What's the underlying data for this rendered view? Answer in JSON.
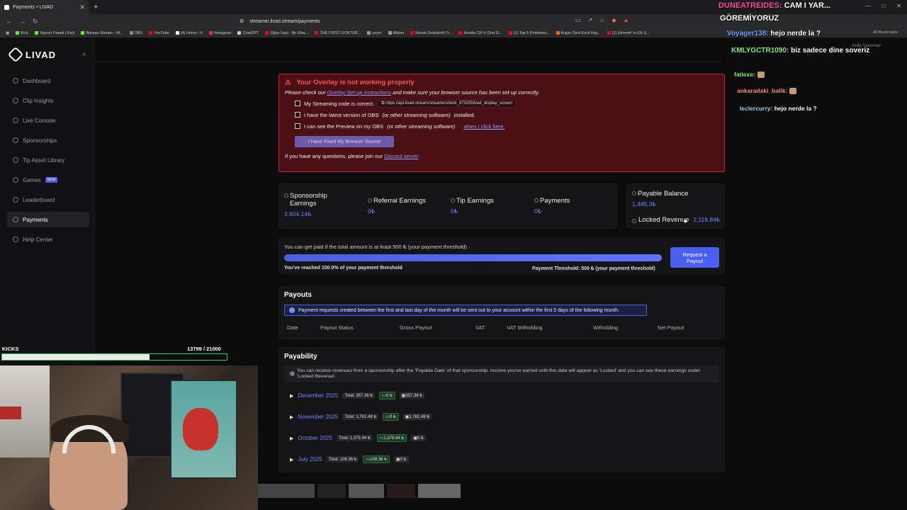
{
  "browser": {
    "tab_title": "Payments • LIVAD",
    "url": "streamer.livad.stream/payments",
    "bookmarks": [
      {
        "label": "Kick",
        "color": "#53fc18"
      },
      {
        "label": "Yayıncı Paneli | Kick",
        "color": "#53fc18"
      },
      {
        "label": "İlkinsan Stream - W...",
        "color": "#53fc18"
      },
      {
        "label": "OBS",
        "color": "#888888"
      },
      {
        "label": "YouTube",
        "color": "#ff0000"
      },
      {
        "label": "(4) Home / X",
        "color": "#ffffff"
      },
      {
        "label": "Instagram",
        "color": "#e1306c"
      },
      {
        "label": "ChatGPT",
        "color": "#cccccc"
      },
      {
        "label": "Oğuz Sasi - Bir Efsa...",
        "color": "#ff0000"
      },
      {
        "label": "THE FIRST GOKTUR...",
        "color": "#ff0000"
      },
      {
        "label": "yeyın",
        "color": "#999999"
      },
      {
        "label": "Albüm",
        "color": "#999999"
      },
      {
        "label": "Merab Dvalishvili Tr...",
        "color": "#ff0000"
      },
      {
        "label": "Honda CR-V (2nd G...",
        "color": "#ff0000"
      },
      {
        "label": "(1) Top 5 Problems...",
        "color": "#ff0000"
      },
      {
        "label": "Kişiye Özel Evcil Hay...",
        "color": "#ff6600"
      },
      {
        "label": "(1) Edremit' in EN S...",
        "color": "#ff0000"
      }
    ],
    "all_bookmarks": "All Bookmarks"
  },
  "sidebar": {
    "brand": "LIVAD",
    "items": [
      {
        "label": "Dashboard",
        "icon": "dashboard-icon"
      },
      {
        "label": "Clip Insights",
        "icon": "clip-icon"
      },
      {
        "label": "Live Console",
        "icon": "console-icon"
      },
      {
        "label": "Sponsorships",
        "icon": "sponsorship-icon"
      },
      {
        "label": "Tip Asset Library",
        "icon": "library-icon"
      },
      {
        "label": "Games",
        "icon": "games-icon",
        "badge": "NEW"
      },
      {
        "label": "Leaderboard",
        "icon": "leaderboard-icon"
      },
      {
        "label": "Payments",
        "icon": "payments-icon",
        "active": true
      },
      {
        "label": "Help Center",
        "icon": "help-icon"
      }
    ]
  },
  "alert": {
    "title": "Your Overlay is not working properly",
    "sub_prefix": "Please check our ",
    "sub_link": "Overlay Set-up Instructions",
    "sub_suffix": " and make sure your browser source has been set up correctly.",
    "check1": "My Streaming code is correct.",
    "code": "https://api.livad.stream/streamers/kick_9732556/ad_display_screen",
    "check2_prefix": "I have the latest version of OBS ",
    "check2_em": "(or other streaming software)",
    "check2_suffix": " installed.",
    "check3_prefix": "I can see the Preview on my OBS ",
    "check3_em": "(or other streaming software)",
    "check3_link": "when I click here.",
    "fixed_button": "I Have Fixed My Browser Source",
    "foot_prefix": "If you have any questions, please join our ",
    "foot_link": "Discord server"
  },
  "earnings": {
    "sponsorship_label": "Sponsorship Earnings",
    "sponsorship_value": "3,604.14₺",
    "referral_label": "Referral Earnings",
    "referral_value": "0₺",
    "tip_label": "Tip Earnings",
    "tip_value": "0₺",
    "payments_label": "Payments",
    "payments_value": "0₺"
  },
  "balance": {
    "payable_label": "Payable Balance",
    "payable_value": "1,485.3₺",
    "locked_label": "Locked Revenue",
    "locked_value": "2,118.84₺"
  },
  "threshold": {
    "text": "You can get paid if the total amount is at least 500 ₺ (your payment threshold)",
    "progress_percent": 100,
    "reached": "You've reached 100.0% of your payment threshold",
    "right": "Payment Threshold: 500 ₺ (your payment threshold)",
    "button": "Request a Payout"
  },
  "payouts": {
    "title": "Payouts",
    "info": "Payment requests created between the first and last day of the month will be sent out to your account within the first 5 days of the following month.",
    "columns": [
      "Date",
      "Payout Status",
      "Gross Payout",
      "VAT",
      "VAT Witholding",
      "Witholding",
      "Net Payout"
    ]
  },
  "payability": {
    "title": "Payability",
    "info": "You can receive revenues from a sponsorship after the 'Payable Date' of that sponsorship. Income you've earned until this date will appear as 'Locked' and you can see these earnings under 'Locked Revenue'.",
    "months": [
      {
        "name": "December 2025",
        "total": "Total: 357.36 ₺",
        "payable": "0 ₺",
        "locked": "357.36 ₺"
      },
      {
        "name": "November 2025",
        "total": "Total: 1,761.48 ₺",
        "payable": "0 ₺",
        "locked": "1,761.48 ₺"
      },
      {
        "name": "October 2025",
        "total": "Total: 1,376.94 ₺",
        "payable": "1,376.94 ₺",
        "locked": "0 ₺"
      },
      {
        "name": "July 2025",
        "total": "Total: 108.36 ₺",
        "payable": "108.36 ₺",
        "locked": "0 ₺"
      }
    ]
  },
  "stream": {
    "kicks_label": "KICKS",
    "kicks_count": "13799  / 21000",
    "kicks_fraction": 0.657
  },
  "chat": {
    "messages": [
      {
        "user": "DUNEATREIDES:",
        "text": "CAM I YAR..."
      },
      {
        "user": "",
        "text": "GÖREMİYORUZ"
      },
      {
        "user": "Voyager138:",
        "text": "hejo nerde la ?"
      },
      {
        "user": "KMLYGCTR1090:",
        "text": "biz sadece dine soveriz"
      },
      {
        "user": "fatiexe:",
        "text": ""
      },
      {
        "user": "ankaradaki_balik:",
        "text": ""
      },
      {
        "user": "leclercurry:",
        "text": "hejo nerde la ?"
      }
    ],
    "sub": "Arda Yaramaz"
  }
}
